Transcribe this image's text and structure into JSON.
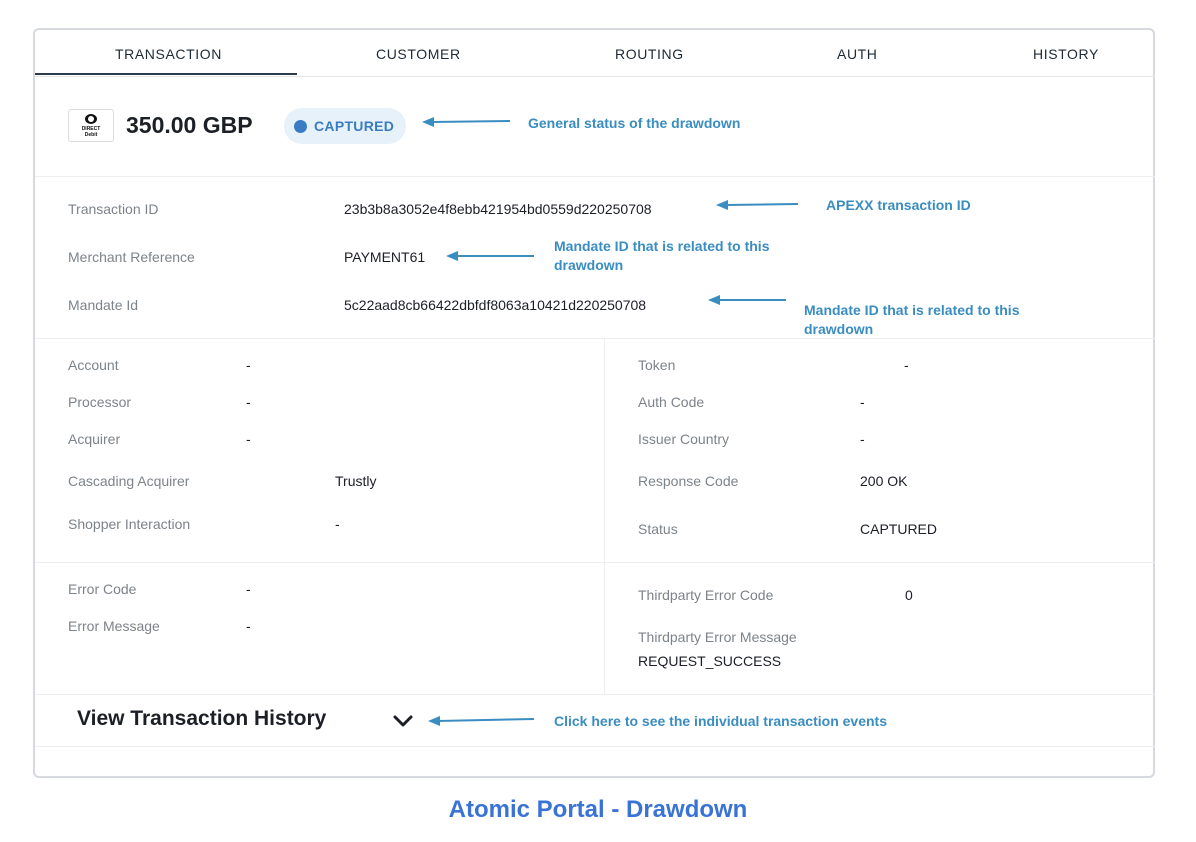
{
  "tabs": [
    "TRANSACTION",
    "CUSTOMER",
    "ROUTING",
    "AUTH",
    "HISTORY"
  ],
  "header": {
    "logo_lines": [
      "DIRECT",
      "Debit"
    ],
    "amount": "350.00 GBP",
    "status": "CAPTURED"
  },
  "ids": {
    "transaction_id_label": "Transaction ID",
    "transaction_id": "23b3b8a3052e4f8ebb421954bd0559d220250708",
    "merchant_ref_label": "Merchant Reference",
    "merchant_ref": "PAYMENT61",
    "mandate_id_label": "Mandate Id",
    "mandate_id": "5c22aad8cb66422dbfdf8063a10421d220250708"
  },
  "left_details": [
    {
      "label": "Account",
      "value": "-"
    },
    {
      "label": "Processor",
      "value": "-"
    },
    {
      "label": "Acquirer",
      "value": "-"
    },
    {
      "label": "Cascading Acquirer",
      "value": "Trustly"
    },
    {
      "label": "Shopper Interaction",
      "value": "-"
    }
  ],
  "right_details": [
    {
      "label": "Token",
      "value": "-"
    },
    {
      "label": "Auth Code",
      "value": "-"
    },
    {
      "label": "Issuer Country",
      "value": "-"
    },
    {
      "label": "Response Code",
      "value": "200 OK"
    },
    {
      "label": "Status",
      "value": "CAPTURED"
    }
  ],
  "errors": {
    "error_code_label": "Error Code",
    "error_code": "-",
    "error_message_label": "Error Message",
    "error_message": "-",
    "thirdparty_code_label": "Thirdparty Error Code",
    "thirdparty_code": "0",
    "thirdparty_message_label": "Thirdparty Error Message",
    "thirdparty_message": "REQUEST_SUCCESS"
  },
  "history": {
    "title": "View Transaction History"
  },
  "annotations": {
    "status_note": "General status of the drawdown",
    "txn_note": "APEXX transaction ID",
    "merchant_note_line1": "Mandate ID that is related to this",
    "merchant_note_line2": "drawdown",
    "mandate_note_line1": "Mandate ID that is related to this",
    "mandate_note_line2": "drawdown",
    "history_note": "Click here to see the individual transaction events"
  },
  "caption": "Atomic Portal - Drawdown",
  "colors": {
    "annotation": "#3a8dc1",
    "status_accent": "#3a7cc3",
    "caption": "#3a73d6"
  },
  "icons": [
    "direct-debit-logo",
    "chevron-down-icon",
    "arrow-left-icon"
  ]
}
